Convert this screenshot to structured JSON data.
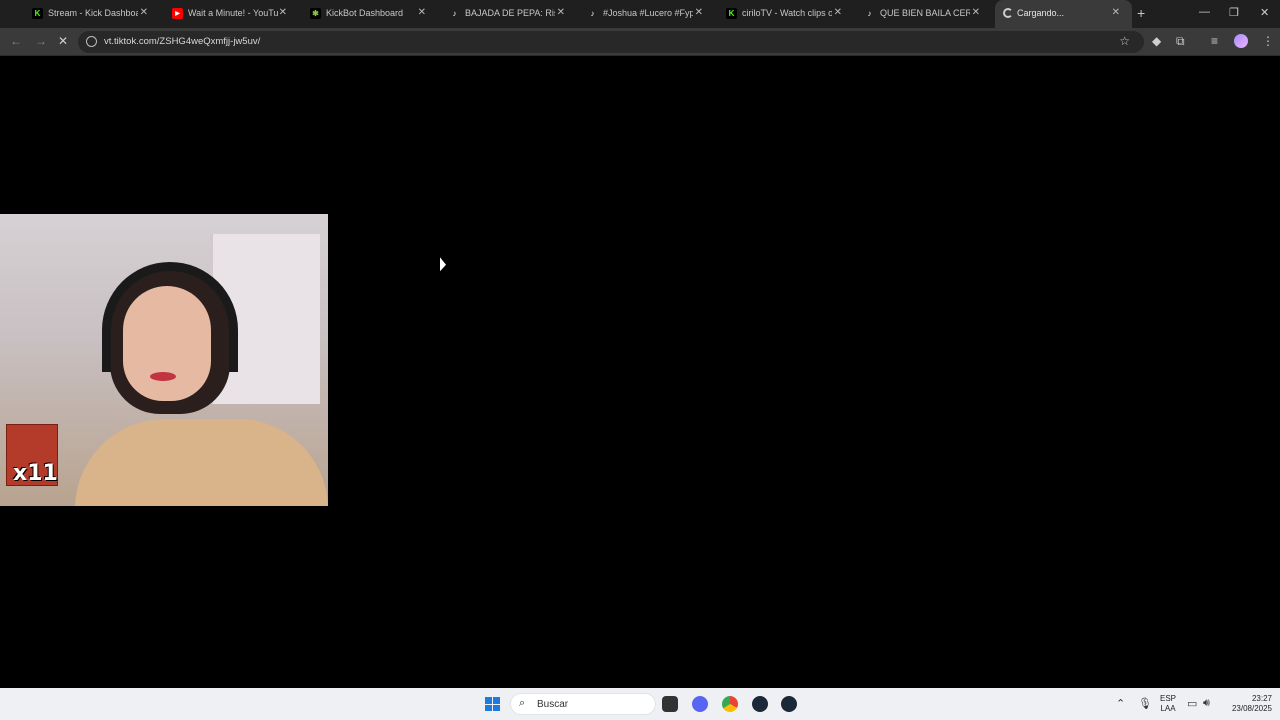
{
  "tabs": [
    {
      "title": "Stream - Kick Dashboard",
      "favicon": "kick-icon",
      "color": "#53fc18"
    },
    {
      "title": "Wait a Minute! - YouTube",
      "favicon": "youtube-icon",
      "color": "#ff0000"
    },
    {
      "title": "KickBot Dashboard",
      "favicon": "kickbot-icon",
      "color": "#8bc34a"
    },
    {
      "title": "BAJADA DE PEPA: Risas y",
      "favicon": "tiktok-icon",
      "color": "#ffffff"
    },
    {
      "title": "#Joshua #Lucero #Fyp #V",
      "favicon": "tiktok-icon",
      "color": "#ffffff"
    },
    {
      "title": "ciriloTV - Watch clips on",
      "favicon": "kick-icon",
      "color": "#53fc18"
    },
    {
      "title": "QUE BIEN BAILA CERDIN",
      "favicon": "tiktok-icon",
      "color": "#ffffff"
    },
    {
      "title": "Cargando...",
      "favicon": "loading-icon",
      "color": "#cccccc"
    }
  ],
  "address_bar": {
    "url": "vt.tiktok.com/ZSHG4weQxmfjj-jw5uv/"
  },
  "video_overlay": {
    "multiplier": "x11"
  },
  "taskbar": {
    "search_placeholder": "Buscar",
    "lang_primary": "ESP",
    "lang_secondary": "LAA",
    "time": "23:27",
    "date": "23/08/2025"
  }
}
